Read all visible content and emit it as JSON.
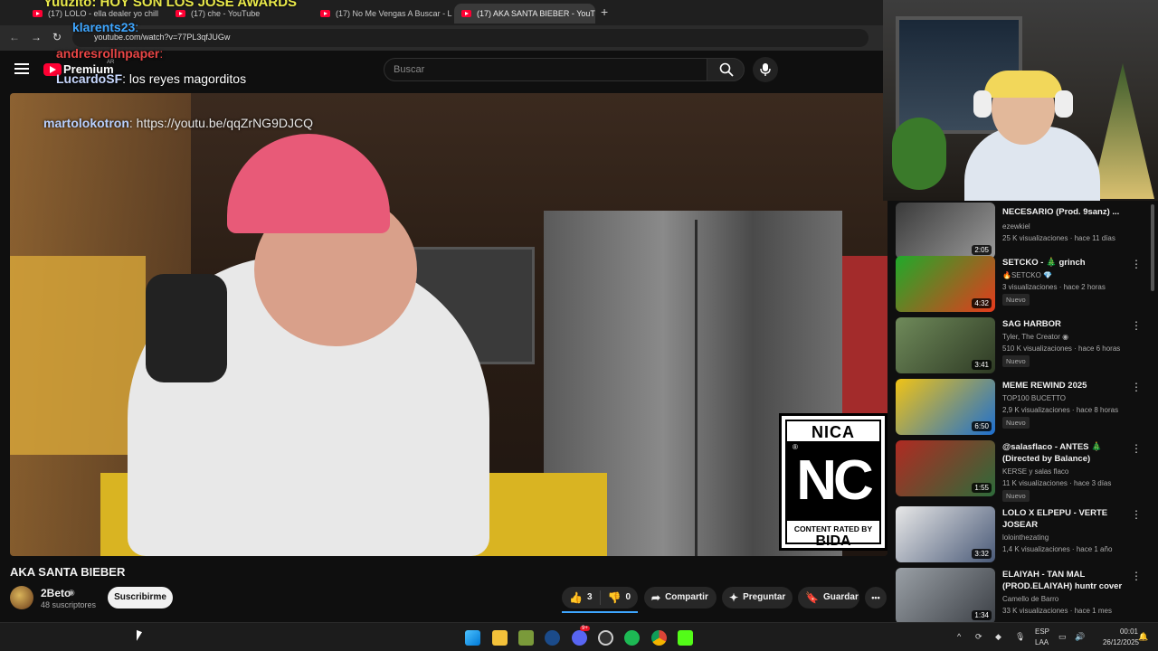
{
  "browser": {
    "tabs": [
      {
        "label": "(17) LOLO - ella dealer yo chill",
        "active": false
      },
      {
        "label": "(17) che - YouTube",
        "active": false
      },
      {
        "label": "(17) No Me Vengas A Buscar - L",
        "active": false
      },
      {
        "label": "(17) AKA SANTA BIEBER - YouT",
        "active": true
      }
    ],
    "new_tab": "+",
    "url": "youtube.com/watch?v=77PL3qfJUGw"
  },
  "header": {
    "brand": "Premium",
    "brand_cc": "AR",
    "search_placeholder": "Buscar"
  },
  "chat_overlay": [
    {
      "user": "Yuuzito",
      "text": ": HOY SON LOS JOSE AWARDS",
      "color": "#e8e84a"
    },
    {
      "user": "klarents23",
      "text": ":",
      "color": "#3ea6ff"
    },
    {
      "user": "andresrollnpaper",
      "text": ":",
      "color": "#e84545"
    },
    {
      "user": "LucardoSF",
      "text": ": los reyes magorditos",
      "color": "#c8d8ff"
    },
    {
      "user": "martolokotron",
      "text": ": https://youtu.be/qqZrNG9DJCQ",
      "color": "#b8d0ff"
    }
  ],
  "rating_badge": {
    "top": "NICA",
    "big": "NC",
    "reg": "®",
    "line1": "CONTENT RATED BY",
    "line2": "BIDA"
  },
  "video": {
    "title": "AKA SANTA BIEBER",
    "channel": "2Beto",
    "verified": "◉",
    "subscribers": "48 suscriptores",
    "subscribe_label": "Suscribirme",
    "likes": "3",
    "dislikes": "0",
    "share_label": "Compartir",
    "ask_label": "Preguntar",
    "save_label": "Guardar",
    "more_label": "•••"
  },
  "recommendations": [
    {
      "title": "NECESARIO (Prod. 9sanz) ...",
      "channel": "ezewkiel",
      "meta": "25 K visualizaciones · hace 11 días",
      "duration": "2:05",
      "new": "",
      "colors": [
        "#3a3a3a",
        "#9a9a9a"
      ]
    },
    {
      "title": "SETCKO - 🎄 grinch",
      "channel": "🔥SETCKO 💎",
      "meta": "3 visualizaciones · hace 2 horas",
      "duration": "4:32",
      "new": "Nuevo",
      "colors": [
        "#1faa2a",
        "#e63a1c"
      ]
    },
    {
      "title": "SAG HARBOR",
      "channel": "Tyler, The Creator ◉",
      "meta": "510 K visualizaciones · hace 6 horas",
      "duration": "3:41",
      "new": "Nuevo",
      "colors": [
        "#6f8a5a",
        "#2e3a24"
      ]
    },
    {
      "title": "MEME REWIND 2025",
      "channel": "TOP100 BUCETTO",
      "meta": "2,9 K visualizaciones · hace 8 horas",
      "duration": "6:50",
      "new": "Nuevo",
      "colors": [
        "#f0c316",
        "#1d6fd0"
      ]
    },
    {
      "title": "@salasflaco - ANTES 🎄 (Directed by Balance)",
      "channel": "KERSE y salas flaco",
      "meta": "11 K visualizaciones · hace 3 días",
      "duration": "1:55",
      "new": "Nuevo",
      "colors": [
        "#b02a22",
        "#2d6b3a"
      ]
    },
    {
      "title": "LOLO X ELPEPU - VERTE JOSEAR",
      "channel": "lolointhezating",
      "meta": "1,4 K visualizaciones · hace 1 año",
      "duration": "3:32",
      "new": "",
      "colors": [
        "#e8e8e8",
        "#4a5a78"
      ]
    },
    {
      "title": "ELAIYAH - TAN MAL (PROD.ELAIYAH) huntr cover",
      "channel": "Camello de Barro",
      "meta": "33 K visualizaciones · hace 1 mes",
      "duration": "1:34",
      "new": "",
      "colors": [
        "#9aa0a6",
        "#3b3f45"
      ]
    }
  ],
  "taskbar": {
    "lang_top": "ESP",
    "lang_bottom": "LAA",
    "time": "00:01",
    "date": "26/12/2025",
    "chat_badge": "9+"
  }
}
